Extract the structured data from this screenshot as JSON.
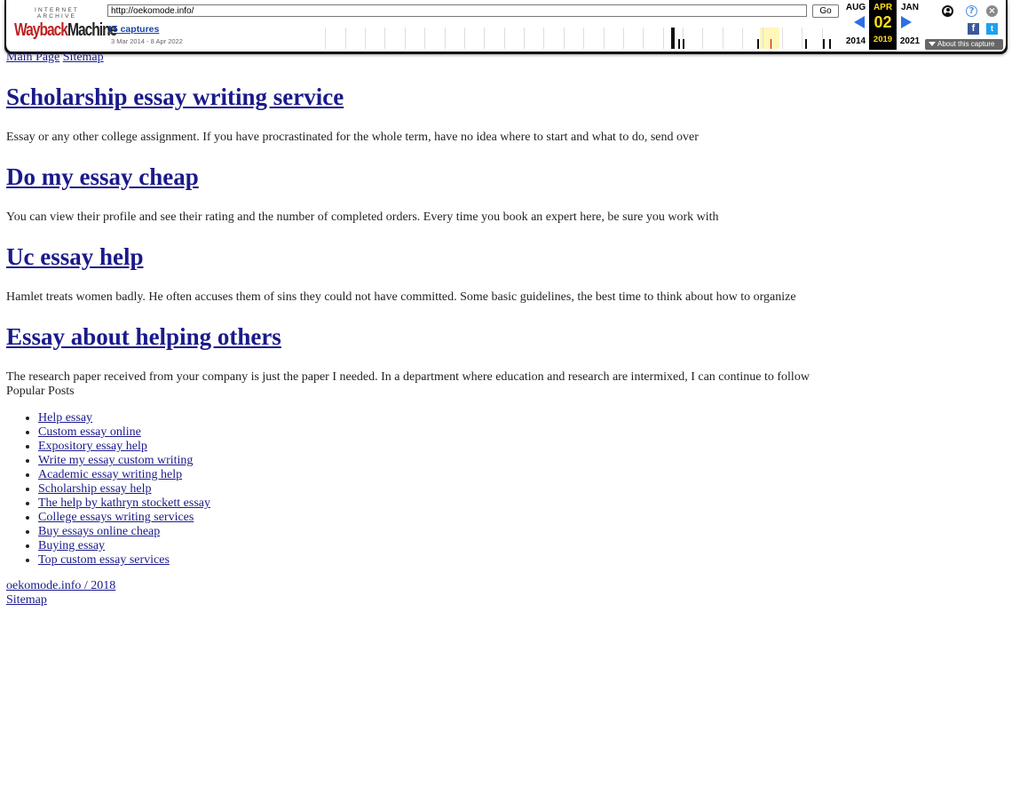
{
  "toolbar": {
    "logo_top": "INTERNET ARCHIVE",
    "logo_wayback": "Wayback",
    "logo_machine": "Machine",
    "url": "http://oekomode.info/",
    "go_label": "Go",
    "captures": "15 captures",
    "date_range": "3 Mar 2014 - 8 Apr 2022",
    "prev": {
      "month": "AUG",
      "year": "2014"
    },
    "current": {
      "month": "APR",
      "day": "02",
      "year": "2019"
    },
    "next": {
      "month": "JAN",
      "year": "2021"
    },
    "about_label": "About this capture",
    "icons": [
      "user-icon",
      "help-icon",
      "close-icon",
      "facebook-icon",
      "twitter-icon"
    ],
    "accent_color": "#ffdc1f"
  },
  "nav": {
    "main_page": "Main Page",
    "sitemap": "Sitemap"
  },
  "articles": [
    {
      "title": "Scholarship essay writing service",
      "excerpt": "Essay or any other college assignment. If you have procrastinated for the whole term, have no idea where to start and what to do, send over"
    },
    {
      "title": "Do my essay cheap",
      "excerpt": "You can view their profile and see their rating and the number of completed orders. Every time you book an expert here, be sure you work with"
    },
    {
      "title": "Uc essay help",
      "excerpt": "Hamlet treats women badly. He often accuses them of sins they could not have committed. Some basic guidelines, the best time to think about how to organize"
    },
    {
      "title": "Essay about helping others",
      "excerpt": "The research paper received from your company is just the paper I needed. In a department where education and research are intermixed, I can continue to follow"
    }
  ],
  "popular": {
    "title": "Popular Posts",
    "items": [
      "Help essay",
      "Custom essay online",
      "Expository essay help",
      "Write my essay custom writing",
      "Academic essay writing help",
      "Scholarship essay help",
      "The help by kathryn stockett essay",
      "College essays writing services",
      "Buy essays online cheap",
      "Buying essay",
      "Top custom essay services"
    ]
  },
  "footer": {
    "copyright": "oekomode.info / 2018",
    "sitemap": "Sitemap"
  }
}
